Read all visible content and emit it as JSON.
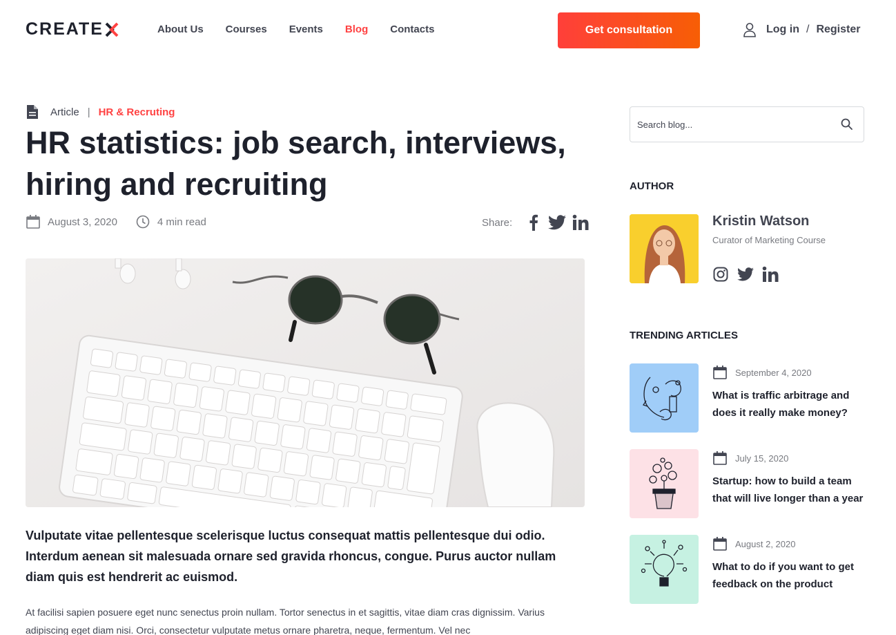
{
  "header": {
    "logo_main": "CREATE",
    "logo_accent": "X",
    "nav": [
      "About Us",
      "Courses",
      "Events",
      "Blog",
      "Contacts"
    ],
    "cta_label": "Get consultation",
    "login_label": "Log in",
    "separator": "/",
    "register_label": "Register"
  },
  "article": {
    "type_label": "Article",
    "divider": "|",
    "category": "HR & Recruting",
    "title": "HR statistics: job search, interviews, hiring and recruiting",
    "date": "August 3, 2020",
    "read_time": "4 min read",
    "share_label": "Share:",
    "lead": "Vulputate vitae pellentesque scelerisque luctus consequat mattis pellentesque dui odio. Interdum aenean sit malesuada ornare sed gravida rhoncus, congue. Purus auctor nullam diam quis est hendrerit ac euismod.",
    "body": "At facilisi sapien posuere eget nunc senectus proin nullam. Tortor senectus in et sagittis, vitae diam cras dignissim. Varius adipiscing eget diam nisi. Orci, consectetur vulputate metus ornare pharetra, neque, fermentum. Vel nec"
  },
  "sidebar": {
    "search_placeholder": "Search blog...",
    "author_heading": "AUTHOR",
    "author_name": "Kristin Watson",
    "author_role": "Curator of Marketing Course",
    "trending_heading": "TRENDING ARTICLES",
    "trending": [
      {
        "date": "September 4, 2020",
        "title": "What is traffic arbitrage and does it really make money?",
        "color": "#a0cdf8"
      },
      {
        "date": "July 15, 2020",
        "title": "Startup: how to build a team that will live longer than a year",
        "color": "#fde1e6"
      },
      {
        "date": "August 2, 2020",
        "title": "What to do if you want to get feedback on the product",
        "color": "#c6f1e2"
      }
    ]
  },
  "colors": {
    "accent": "#ff4242",
    "heading": "#1e212c",
    "text": "#424551",
    "muted": "#787a80"
  }
}
